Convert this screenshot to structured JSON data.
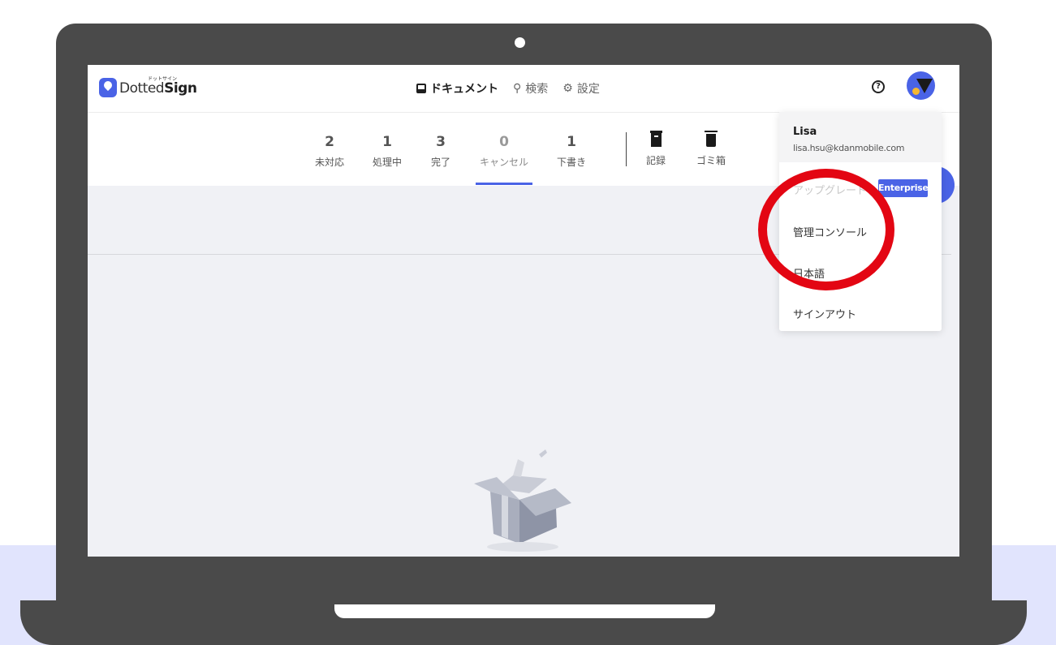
{
  "app": {
    "logo_small": "ドットサイン",
    "logo_text_light": "Dotted",
    "logo_text_bold": "Sign"
  },
  "nav": {
    "items": [
      {
        "label": "ドキュメント",
        "icon": "document-icon",
        "active": true
      },
      {
        "label": "検索",
        "icon": "search-icon",
        "active": false
      },
      {
        "label": "設定",
        "icon": "gear-icon",
        "active": false
      }
    ],
    "help_icon": "?"
  },
  "status_tabs": [
    {
      "count": "2",
      "label": "未対応"
    },
    {
      "count": "1",
      "label": "処理中"
    },
    {
      "count": "3",
      "label": "完了"
    },
    {
      "count": "0",
      "label": "キャンセル"
    },
    {
      "count": "1",
      "label": "下書き"
    }
  ],
  "active_tab": "キャンセル",
  "tools": [
    {
      "label": "記録",
      "icon": "archive-icon"
    },
    {
      "label": "ゴミ箱",
      "icon": "trash-icon"
    }
  ],
  "user_menu": {
    "name": "Lisa",
    "email": "lisa.hsu@kdanmobile.com",
    "items": [
      {
        "label": "アップグレード",
        "badge": "Enterprise"
      },
      {
        "label": "管理コンソール"
      },
      {
        "label": "日本語"
      },
      {
        "label": "サインアウト"
      }
    ]
  },
  "colors": {
    "accent": "#4a63e6",
    "highlight": "#e30613",
    "laptop": "#4a4a4a",
    "desk": "#e1e4fd"
  }
}
